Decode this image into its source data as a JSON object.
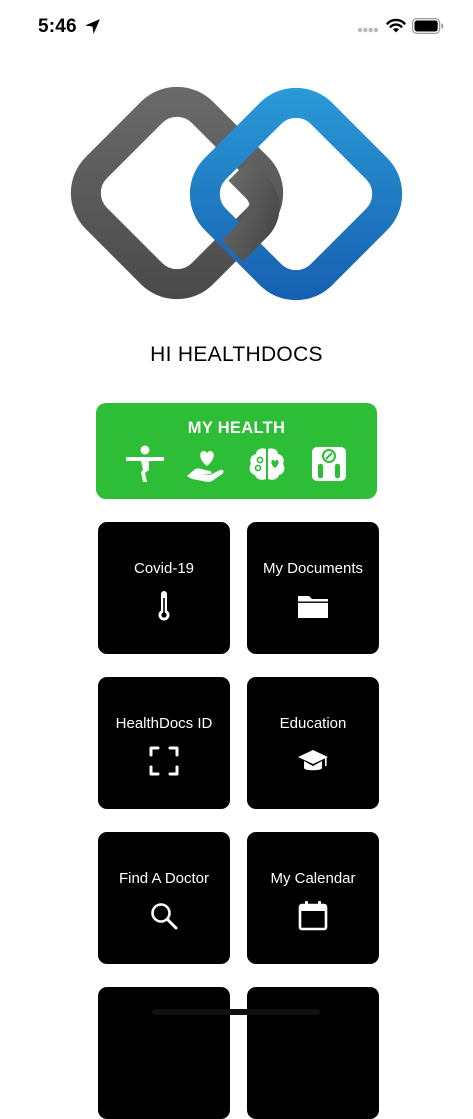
{
  "status_bar": {
    "time": "5:46",
    "icons": [
      "location-arrow-icon",
      "signal-icon",
      "wifi-icon",
      "battery-icon"
    ]
  },
  "app": {
    "title": "HI HEALTHDOCS",
    "logo_colors": {
      "gray": "#5f5f5f",
      "blue": "#1e7fc6"
    }
  },
  "my_health": {
    "label": "MY HEALTH",
    "color": "#2ebd36",
    "icons": [
      "yoga-pose-icon",
      "hand-heart-icon",
      "brain-icon",
      "scale-icon"
    ]
  },
  "tiles": [
    {
      "label": "Covid-19",
      "icon": "thermometer-icon"
    },
    {
      "label": "My Documents",
      "icon": "folder-icon"
    },
    {
      "label": "HealthDocs ID",
      "icon": "scan-frame-icon"
    },
    {
      "label": "Education",
      "icon": "graduation-cap-icon"
    },
    {
      "label": "Find A Doctor",
      "icon": "search-icon"
    },
    {
      "label": "My Calendar",
      "icon": "calendar-icon"
    }
  ]
}
